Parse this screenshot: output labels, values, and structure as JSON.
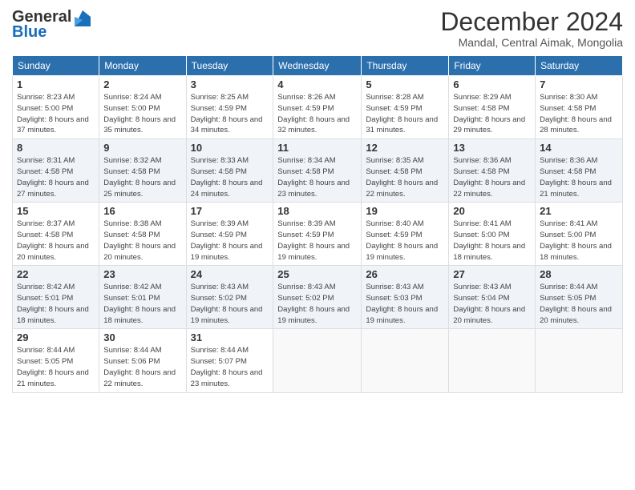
{
  "header": {
    "logo_general": "General",
    "logo_blue": "Blue",
    "title": "December 2024",
    "subtitle": "Mandal, Central Aimak, Mongolia"
  },
  "weekdays": [
    "Sunday",
    "Monday",
    "Tuesday",
    "Wednesday",
    "Thursday",
    "Friday",
    "Saturday"
  ],
  "weeks": [
    [
      {
        "day": "1",
        "sunrise": "Sunrise: 8:23 AM",
        "sunset": "Sunset: 5:00 PM",
        "daylight": "Daylight: 8 hours and 37 minutes."
      },
      {
        "day": "2",
        "sunrise": "Sunrise: 8:24 AM",
        "sunset": "Sunset: 5:00 PM",
        "daylight": "Daylight: 8 hours and 35 minutes."
      },
      {
        "day": "3",
        "sunrise": "Sunrise: 8:25 AM",
        "sunset": "Sunset: 4:59 PM",
        "daylight": "Daylight: 8 hours and 34 minutes."
      },
      {
        "day": "4",
        "sunrise": "Sunrise: 8:26 AM",
        "sunset": "Sunset: 4:59 PM",
        "daylight": "Daylight: 8 hours and 32 minutes."
      },
      {
        "day": "5",
        "sunrise": "Sunrise: 8:28 AM",
        "sunset": "Sunset: 4:59 PM",
        "daylight": "Daylight: 8 hours and 31 minutes."
      },
      {
        "day": "6",
        "sunrise": "Sunrise: 8:29 AM",
        "sunset": "Sunset: 4:58 PM",
        "daylight": "Daylight: 8 hours and 29 minutes."
      },
      {
        "day": "7",
        "sunrise": "Sunrise: 8:30 AM",
        "sunset": "Sunset: 4:58 PM",
        "daylight": "Daylight: 8 hours and 28 minutes."
      }
    ],
    [
      {
        "day": "8",
        "sunrise": "Sunrise: 8:31 AM",
        "sunset": "Sunset: 4:58 PM",
        "daylight": "Daylight: 8 hours and 27 minutes."
      },
      {
        "day": "9",
        "sunrise": "Sunrise: 8:32 AM",
        "sunset": "Sunset: 4:58 PM",
        "daylight": "Daylight: 8 hours and 25 minutes."
      },
      {
        "day": "10",
        "sunrise": "Sunrise: 8:33 AM",
        "sunset": "Sunset: 4:58 PM",
        "daylight": "Daylight: 8 hours and 24 minutes."
      },
      {
        "day": "11",
        "sunrise": "Sunrise: 8:34 AM",
        "sunset": "Sunset: 4:58 PM",
        "daylight": "Daylight: 8 hours and 23 minutes."
      },
      {
        "day": "12",
        "sunrise": "Sunrise: 8:35 AM",
        "sunset": "Sunset: 4:58 PM",
        "daylight": "Daylight: 8 hours and 22 minutes."
      },
      {
        "day": "13",
        "sunrise": "Sunrise: 8:36 AM",
        "sunset": "Sunset: 4:58 PM",
        "daylight": "Daylight: 8 hours and 22 minutes."
      },
      {
        "day": "14",
        "sunrise": "Sunrise: 8:36 AM",
        "sunset": "Sunset: 4:58 PM",
        "daylight": "Daylight: 8 hours and 21 minutes."
      }
    ],
    [
      {
        "day": "15",
        "sunrise": "Sunrise: 8:37 AM",
        "sunset": "Sunset: 4:58 PM",
        "daylight": "Daylight: 8 hours and 20 minutes."
      },
      {
        "day": "16",
        "sunrise": "Sunrise: 8:38 AM",
        "sunset": "Sunset: 4:58 PM",
        "daylight": "Daylight: 8 hours and 20 minutes."
      },
      {
        "day": "17",
        "sunrise": "Sunrise: 8:39 AM",
        "sunset": "Sunset: 4:59 PM",
        "daylight": "Daylight: 8 hours and 19 minutes."
      },
      {
        "day": "18",
        "sunrise": "Sunrise: 8:39 AM",
        "sunset": "Sunset: 4:59 PM",
        "daylight": "Daylight: 8 hours and 19 minutes."
      },
      {
        "day": "19",
        "sunrise": "Sunrise: 8:40 AM",
        "sunset": "Sunset: 4:59 PM",
        "daylight": "Daylight: 8 hours and 19 minutes."
      },
      {
        "day": "20",
        "sunrise": "Sunrise: 8:41 AM",
        "sunset": "Sunset: 5:00 PM",
        "daylight": "Daylight: 8 hours and 18 minutes."
      },
      {
        "day": "21",
        "sunrise": "Sunrise: 8:41 AM",
        "sunset": "Sunset: 5:00 PM",
        "daylight": "Daylight: 8 hours and 18 minutes."
      }
    ],
    [
      {
        "day": "22",
        "sunrise": "Sunrise: 8:42 AM",
        "sunset": "Sunset: 5:01 PM",
        "daylight": "Daylight: 8 hours and 18 minutes."
      },
      {
        "day": "23",
        "sunrise": "Sunrise: 8:42 AM",
        "sunset": "Sunset: 5:01 PM",
        "daylight": "Daylight: 8 hours and 18 minutes."
      },
      {
        "day": "24",
        "sunrise": "Sunrise: 8:43 AM",
        "sunset": "Sunset: 5:02 PM",
        "daylight": "Daylight: 8 hours and 19 minutes."
      },
      {
        "day": "25",
        "sunrise": "Sunrise: 8:43 AM",
        "sunset": "Sunset: 5:02 PM",
        "daylight": "Daylight: 8 hours and 19 minutes."
      },
      {
        "day": "26",
        "sunrise": "Sunrise: 8:43 AM",
        "sunset": "Sunset: 5:03 PM",
        "daylight": "Daylight: 8 hours and 19 minutes."
      },
      {
        "day": "27",
        "sunrise": "Sunrise: 8:43 AM",
        "sunset": "Sunset: 5:04 PM",
        "daylight": "Daylight: 8 hours and 20 minutes."
      },
      {
        "day": "28",
        "sunrise": "Sunrise: 8:44 AM",
        "sunset": "Sunset: 5:05 PM",
        "daylight": "Daylight: 8 hours and 20 minutes."
      }
    ],
    [
      {
        "day": "29",
        "sunrise": "Sunrise: 8:44 AM",
        "sunset": "Sunset: 5:05 PM",
        "daylight": "Daylight: 8 hours and 21 minutes."
      },
      {
        "day": "30",
        "sunrise": "Sunrise: 8:44 AM",
        "sunset": "Sunset: 5:06 PM",
        "daylight": "Daylight: 8 hours and 22 minutes."
      },
      {
        "day": "31",
        "sunrise": "Sunrise: 8:44 AM",
        "sunset": "Sunset: 5:07 PM",
        "daylight": "Daylight: 8 hours and 23 minutes."
      },
      null,
      null,
      null,
      null
    ]
  ]
}
